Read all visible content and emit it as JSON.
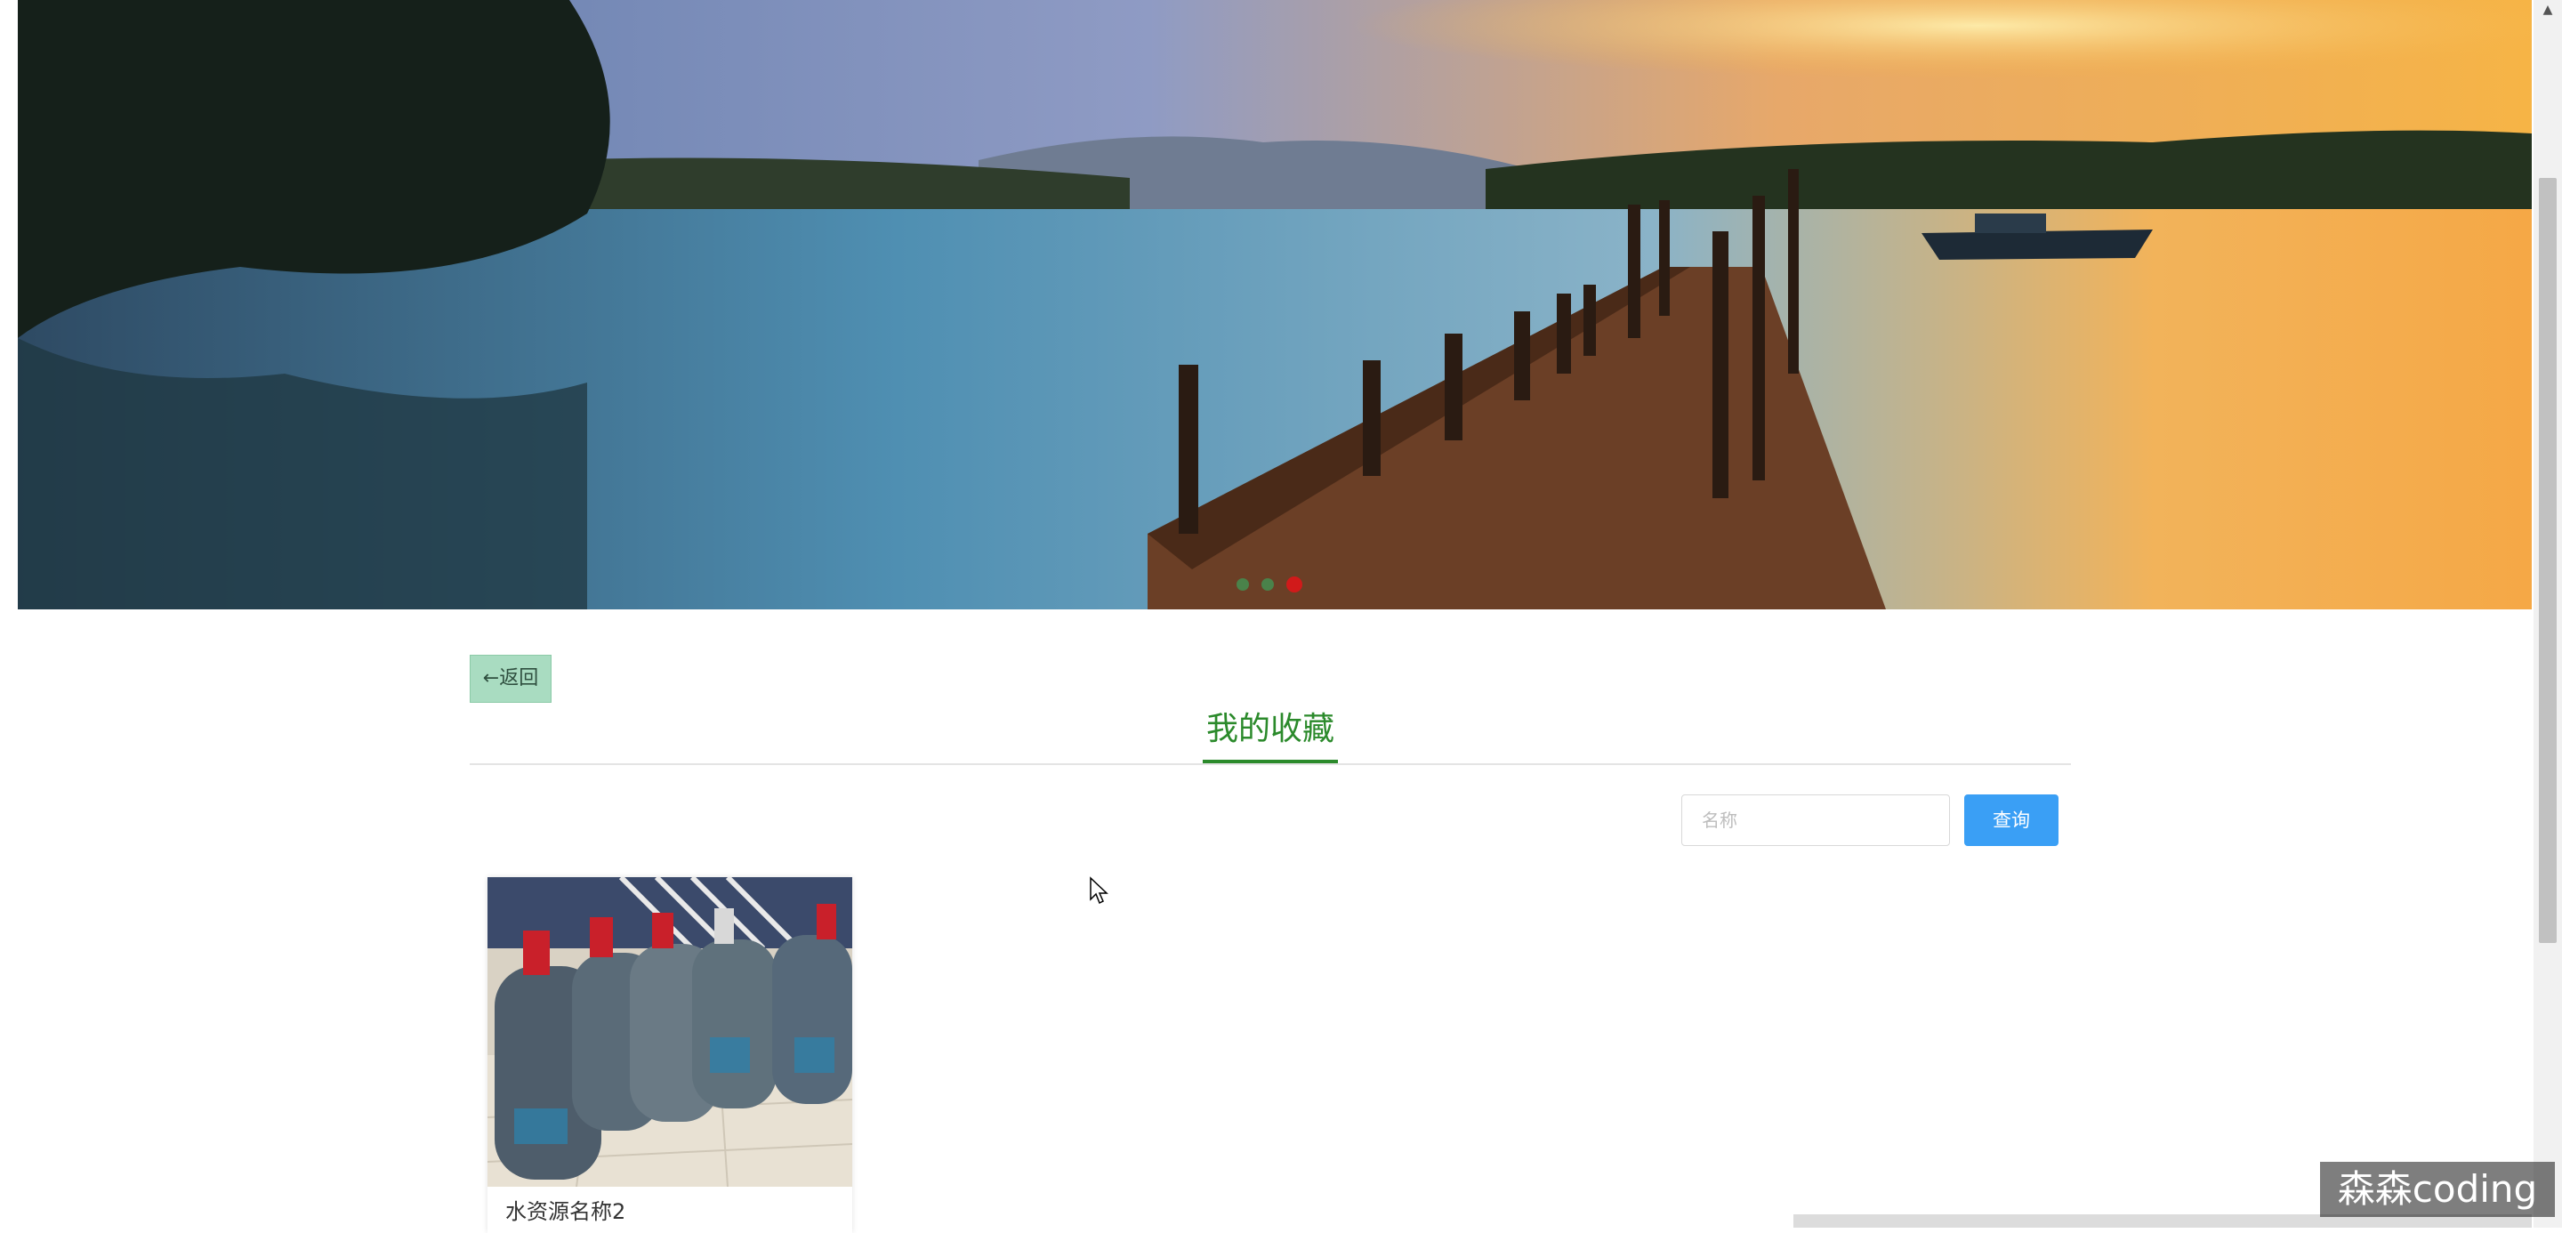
{
  "banner": {
    "slide_count": 3,
    "active_slide": 3
  },
  "back_button": {
    "label": "←返回"
  },
  "page_title": "我的收藏",
  "search": {
    "placeholder": "名称",
    "value": ""
  },
  "query_button": {
    "label": "查询"
  },
  "favorites": [
    {
      "name": "水资源名称2"
    }
  ],
  "watermark": "森森coding",
  "colors": {
    "accent_green": "#2b8a2b",
    "back_button_bg": "#a9dcc1",
    "query_button_bg": "#3a9ff5",
    "active_dot": "#d11a1a"
  }
}
